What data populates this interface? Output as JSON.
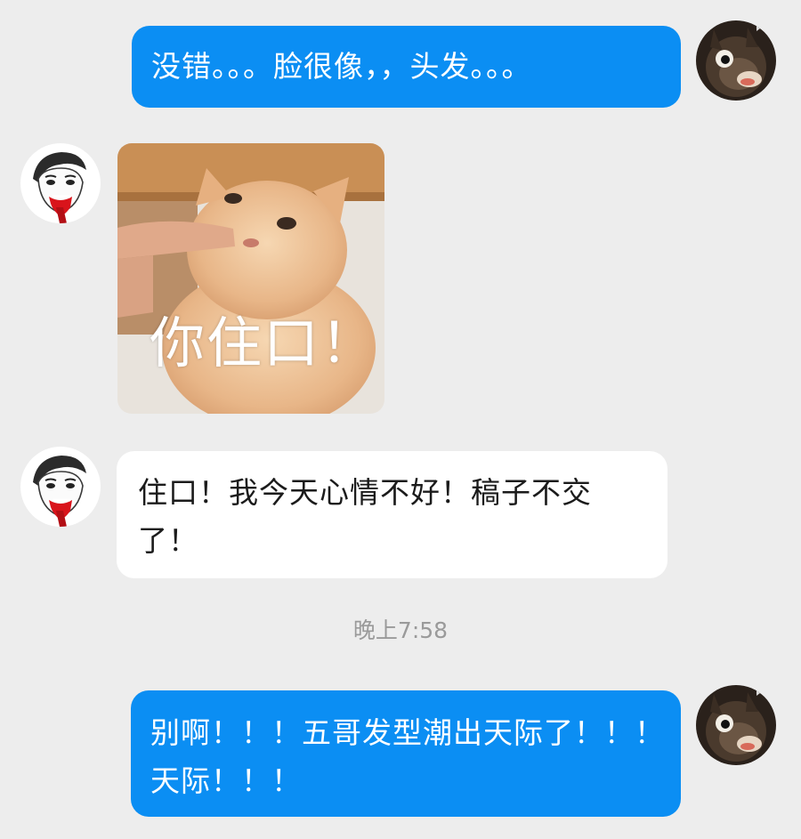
{
  "messages": [
    {
      "sender": "me",
      "text": "没错。。。脸很像，，头发。。。"
    },
    {
      "sender": "friend",
      "type": "sticker",
      "caption": "你住口！"
    },
    {
      "sender": "friend",
      "text": "住口！我今天心情不好！稿子不交了！"
    },
    {
      "sender": "me",
      "text": "别啊！！！五哥发型潮出天际了！！！天际！！！"
    }
  ],
  "timestamp": "晚上7:58",
  "colors": {
    "background": "#ededed",
    "outgoing_bubble": "#0b8ef3",
    "incoming_bubble": "#ffffff",
    "timestamp_text": "#9a9a9a"
  },
  "icons": {
    "me_avatar": "donkey-avatar-icon",
    "friend_avatar": "sketch-face-avatar-icon"
  }
}
